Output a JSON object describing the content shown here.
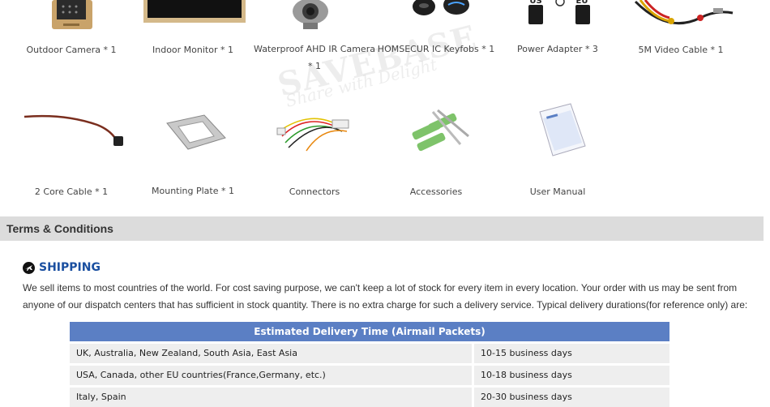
{
  "watermark": {
    "brand": "SAVEBASE",
    "tagline": "Share with Delight"
  },
  "package_items": [
    {
      "label_line1": "Outdoor Camera * 1",
      "label_line2": ""
    },
    {
      "label_line1": "Indoor Monitor * 1",
      "label_line2": ""
    },
    {
      "label_line1": "Waterproof AHD IR Camera",
      "label_line2": "* 1"
    },
    {
      "label_line1": "HOMSECUR IC Keyfobs * 1",
      "label_line2": ""
    },
    {
      "label_line1": "Power Adapter * 3",
      "label_line2": ""
    },
    {
      "label_line1": "5M Video Cable * 1",
      "label_line2": ""
    },
    {
      "label_line1": "2 Core Cable * 1",
      "label_line2": ""
    },
    {
      "label_line1": "Mounting Plate * 1",
      "label_line2": ""
    },
    {
      "label_line1": "Connectors",
      "label_line2": ""
    },
    {
      "label_line1": "Accessories",
      "label_line2": ""
    },
    {
      "label_line1": "User Manual",
      "label_line2": ""
    }
  ],
  "adapter_plugs": {
    "left": "US",
    "right": "EU"
  },
  "terms": {
    "title": "Terms & Conditions"
  },
  "shipping": {
    "title": "SHIPPING",
    "text": "We sell items to most countries of the world. For cost saving purpose, we can't keep a lot of stock for every item in every location. Your order with us may be sent from anyone of our dispatch centers that has sufficient in stock quantity. There is no extra charge for such a delivery service. Typical delivery durations(for reference only) are:"
  },
  "delivery_table": {
    "header": "Estimated Delivery Time (Airmail Packets)",
    "rows": [
      {
        "region": "UK, Australia, New Zealand, South Asia, East Asia",
        "time": "10-15 business days"
      },
      {
        "region": "USA, Canada, other EU countries(France,Germany, etc.)",
        "time": "10-18 business days"
      },
      {
        "region": "Italy, Spain",
        "time": "20-30 business days"
      }
    ]
  },
  "colors": {
    "accent": "#1a4fa0",
    "table_header": "#5b7fc4",
    "bar": "#dcdcdc"
  }
}
